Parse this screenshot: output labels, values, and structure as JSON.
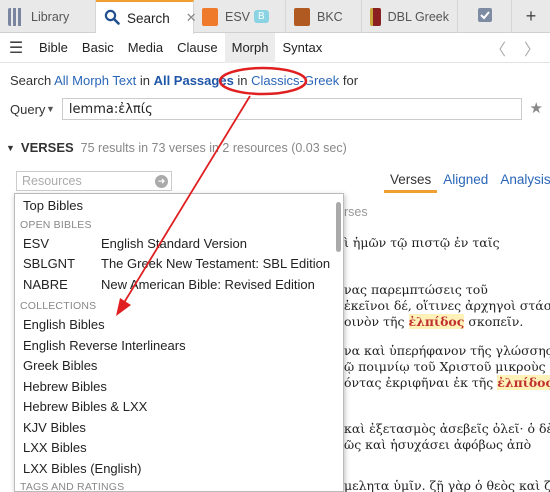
{
  "tabs": [
    {
      "label": "Library",
      "icon": "library-icon"
    },
    {
      "label": "Search",
      "icon": "search-icon"
    },
    {
      "label": "ESV",
      "badge": "B",
      "icon": "esv-book-icon"
    },
    {
      "label": "BKC",
      "icon": "bkc-book-icon"
    },
    {
      "label": "DBL Greek",
      "icon": "dbl-book-icon"
    }
  ],
  "menu": {
    "items": [
      "Bible",
      "Basic",
      "Media",
      "Clause",
      "Morph",
      "Syntax"
    ],
    "active": "Morph"
  },
  "search_line": {
    "prefix": "Search ",
    "morph_text": "All Morph Text",
    "in1": " in ",
    "passages": "All Passages",
    "in2": " in ",
    "collection": "Classics-Greek",
    "for": " for"
  },
  "query": {
    "label": "Query",
    "value": "lemma:ἐλπίς"
  },
  "verses": {
    "title": "VERSES",
    "summary": "75 results in 73 verses in 2 resources (0.03 sec)"
  },
  "resources_input": {
    "placeholder": "Resources"
  },
  "view_tabs": [
    "Verses",
    "Aligned",
    "Analysis"
  ],
  "dropdown": {
    "top_item": "Top Bibles",
    "open_bibles_header": "OPEN BIBLES",
    "open_bibles": [
      {
        "abbr": "ESV",
        "name": "English Standard Version"
      },
      {
        "abbr": "SBLGNT",
        "name": "The Greek New Testament: SBL Edition"
      },
      {
        "abbr": "NABRE",
        "name": "New American Bible: Revised Edition"
      }
    ],
    "collections_header": "COLLECTIONS",
    "collections": [
      "English Bibles",
      "English Reverse Interlinears",
      "Greek Bibles",
      "Hebrew Bibles",
      "Hebrew Bibles & LXX",
      "KJV Bibles",
      "LXX Bibles",
      "LXX Bibles (English)"
    ],
    "tags_header": "TAGS AND RATINGS"
  },
  "background_text": {
    "partial_label": "rses",
    "line1": "ὶ ἡμῶν τῷ πιστῷ ἐν ταῖς",
    "line2": "νας παρεμπτώσεις τοῦ",
    "line3": "ἐκεῖνοι δέ, οἵτινες ἀρχηγοὶ στάσεως",
    "line4_a": "οινὸν τῆς ",
    "line4_hl": "ἐλπίδος",
    "line4_b": " σκοπεῖν.",
    "line5": "να καὶ ὑπερήφανον τῆς γλώσσης",
    "line6": "ῷ ποιμνίῳ τοῦ Χριστοῦ μικροὺς καὶ",
    "line7_a": "όντας ἐκριφῆναι ἐκ τῆς ",
    "line7_hl": "ἐλπίδος",
    "line8": "καὶ ἐξετασμὸς ἀσεβεῖς ὀλεῖ· ὁ δὲ",
    "line9": "ῶς καὶ ἡσυχάσει ἀφόβως ἀπὸ",
    "line10": "μελητα ὑμῖν. ζῇ γὰρ ὁ θεὸς καὶ ζῇ"
  },
  "colors": {
    "accent": "#f0a030",
    "link": "#2a66b8",
    "annotation": "#e02020",
    "highlight": "#fff2b8"
  }
}
